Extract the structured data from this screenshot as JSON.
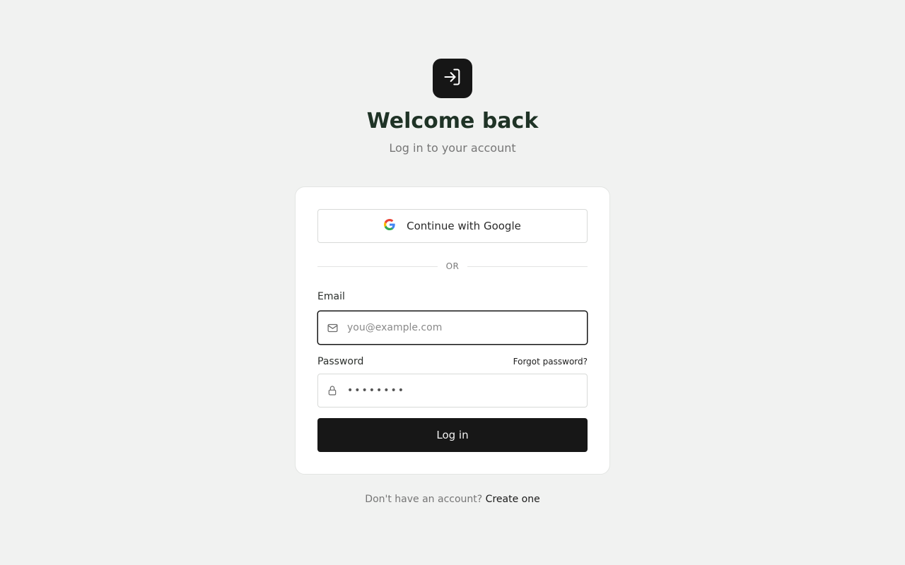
{
  "header": {
    "logo_icon": "login-arrow-icon",
    "title": "Welcome back",
    "subtitle": "Log in to your account"
  },
  "card": {
    "google_button_label": "Continue with Google",
    "google_icon": "google-g-icon",
    "divider_label": "OR",
    "email": {
      "label": "Email",
      "placeholder": "you@example.com",
      "value": "",
      "icon": "mail-icon"
    },
    "password": {
      "label": "Password",
      "value": "••••••••",
      "icon": "lock-icon",
      "forgot_label": "Forgot password?"
    },
    "login_button_label": "Log in"
  },
  "footer": {
    "prompt": "Don't have an account?",
    "link_label": "Create one"
  },
  "colors": {
    "background": "#f1f2f1",
    "primary_button": "#171717",
    "title": "#1f3326"
  }
}
